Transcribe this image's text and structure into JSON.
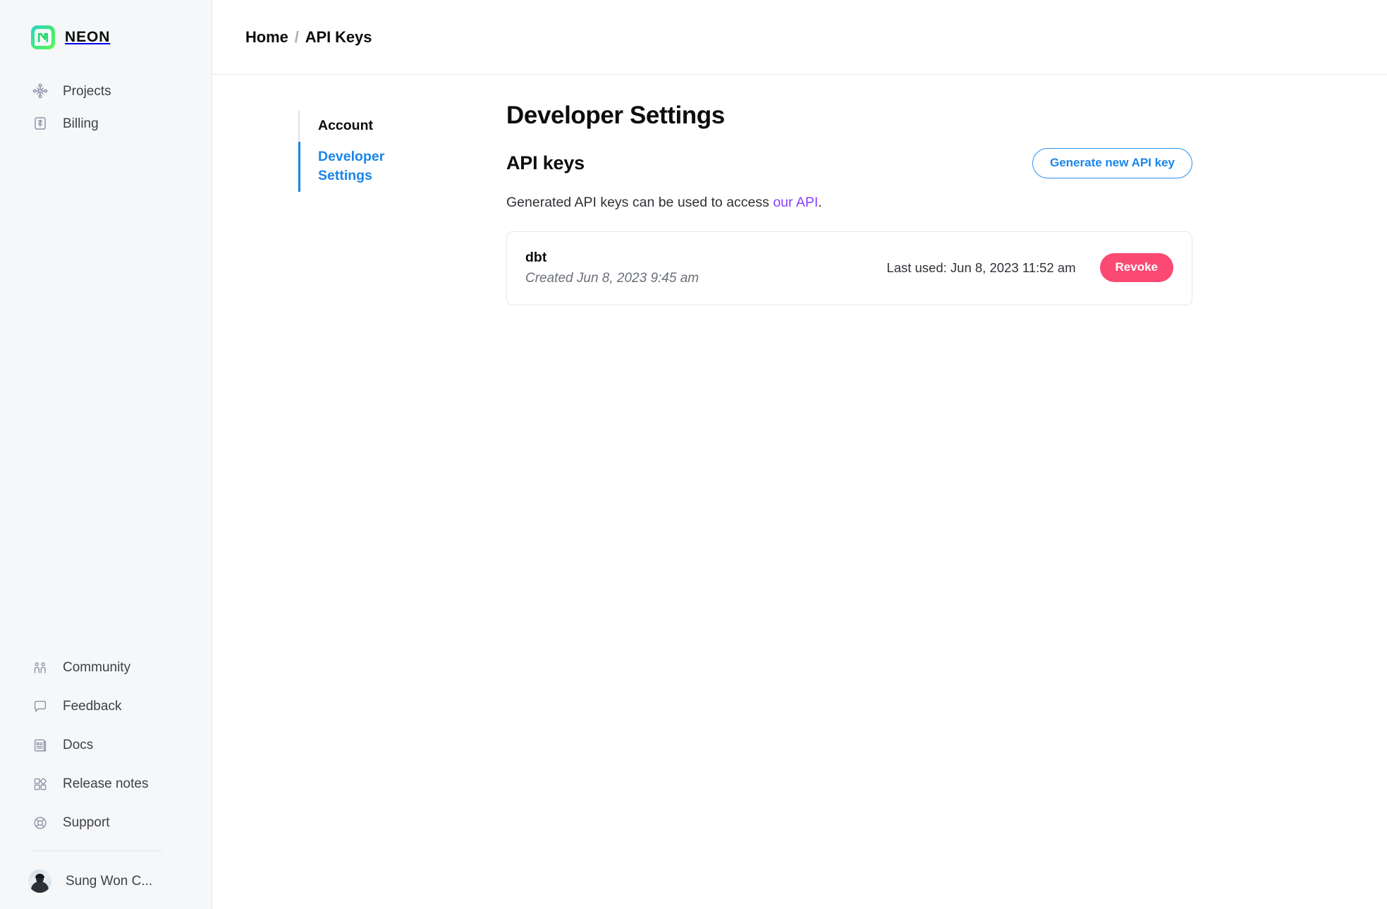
{
  "brand": {
    "name": "NEON",
    "logo_icon": "neon-logo-icon",
    "gradient_from": "#2fd3c8",
    "gradient_to": "#62f755"
  },
  "sidebar": {
    "primary_items": [
      {
        "label": "Projects",
        "icon": "projects-node-icon"
      },
      {
        "label": "Billing",
        "icon": "billing-card-icon"
      }
    ],
    "secondary_items": [
      {
        "label": "Community",
        "icon": "community-people-icon"
      },
      {
        "label": "Feedback",
        "icon": "feedback-chat-icon"
      },
      {
        "label": "Docs",
        "icon": "docs-document-icon"
      },
      {
        "label": "Release notes",
        "icon": "release-notes-grid-icon"
      },
      {
        "label": "Support",
        "icon": "support-lifebuoy-icon"
      }
    ],
    "user": {
      "name": "Sung Won C...",
      "avatar_alt": "user-avatar"
    }
  },
  "topbar": {
    "breadcrumb": {
      "home": "Home",
      "separator": "/",
      "current": "API Keys"
    }
  },
  "subnav": {
    "items": [
      {
        "label": "Account",
        "active": false
      },
      {
        "label": "Developer Settings",
        "active": true
      }
    ],
    "active_color": "#1a85e8"
  },
  "panel": {
    "title": "Developer Settings",
    "section_title": "API keys",
    "generate_button": "Generate new API key",
    "description_prefix": "Generated API keys can be used to access ",
    "description_link": "our API",
    "description_suffix": ".",
    "link_color": "#8a3ffc"
  },
  "api_keys": [
    {
      "name": "dbt",
      "created": "Created Jun 8, 2023 9:45 am",
      "last_used": "Last used: Jun 8, 2023 11:52 am",
      "revoke_label": "Revoke",
      "revoke_color": "#fa4a73"
    }
  ]
}
